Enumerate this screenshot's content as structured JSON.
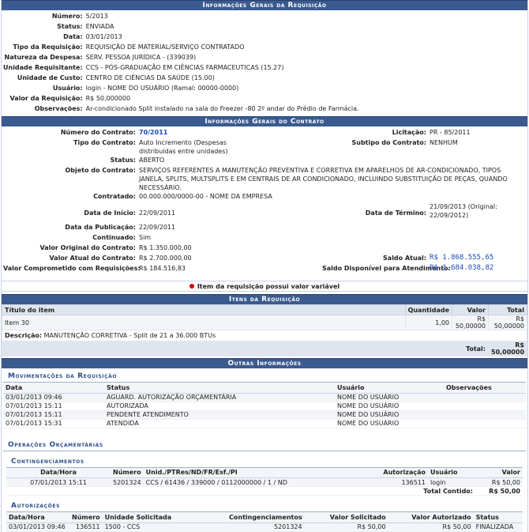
{
  "req": {
    "caption": "Informações Gerais da Requisição",
    "rows": [
      {
        "label": "Número:",
        "value": "5/2013"
      },
      {
        "label": "Status:",
        "value": "ENVIADA"
      },
      {
        "label": "Data:",
        "value": "03/01/2013"
      },
      {
        "label": "Tipo da Requisição:",
        "value": "REQUISIÇÃO DE MATERIAL/SERVIÇO CONTRATADO"
      },
      {
        "label": "Natureza da Despesa:",
        "value": "SERV. PESSOA JURÍDICA - (339039)"
      },
      {
        "label": "Unidade Requisitante:",
        "value": "CCS - PÓS-GRADUAÇÃO EM CIÊNCIAS FARMACEUTICAS (15.27)"
      },
      {
        "label": "Unidade de Custo:",
        "value": "CENTRO DE CIÊNCIAS DA SAÚDE (15.00)"
      },
      {
        "label": "Usuário:",
        "value": "login - NOME DO USUÁRIO (Ramal: 00000-0000)"
      },
      {
        "label": "Valor da Requisição:",
        "value": "R$ 50,000000"
      },
      {
        "label": "Observações:",
        "value": "Ar-condicionado Split instalado na sala do Freezer -80 2º andar do Prédio de Farmácia."
      }
    ]
  },
  "contract": {
    "caption": "Informações Gerais do Contrato",
    "numero_label": "Número do Contrato:",
    "numero": "70/2011",
    "licitacao_label": "Licitação:",
    "licitacao": "PR - 85/2011",
    "tipo_label": "Tipo do Contrato:",
    "tipo": "Auto Incremento (Despesas distribuídas entre unidades)",
    "subtipo_label": "Subtipo do Contrato:",
    "subtipo": "NENHUM",
    "status_label": "Status:",
    "status": "ABERTO",
    "objeto_label": "Objeto do Contrato:",
    "objeto": "SERVIÇOS REFERENTES A MANUTENÇÃO PREVENTIVA E CORRETIVA EM APARELHOS DE AR-CONDICIONADO, TIPOS JANELA, SPLITS, MULTSPLITS E EM CENTRAIS DE AR CONDICIONADO, INCLUINDO SUBSTITUIÇÃO DE PEÇAS, QUANDO NECESSÁRIO.",
    "contratado_label": "Contratado:",
    "contratado": "00.000.000/0000-00 - NOME DA EMPRESA",
    "inicio_label": "Data de Início:",
    "inicio": "22/09/2011",
    "termino_label": "Data de Término:",
    "termino": "21/09/2013 (Original: 22/09/2012)",
    "publicacao_label": "Data da Publicação:",
    "publicacao": "22/09/2011",
    "continuado_label": "Continuado:",
    "continuado": "Sim",
    "valor_original_label": "Valor Original do Contrato:",
    "valor_original": "R$ 1.350.000,00",
    "valor_atual_label": "Valor Atual do Contrato:",
    "valor_atual": "R$ 2.700.000,00",
    "saldo_atual_label": "Saldo Atual:",
    "saldo_atual": "R$ 1.868.555,65",
    "comprometido_label": "Valor Comprometido com Requisições:",
    "comprometido": "R$ 184.516,83",
    "saldo_disp_label": "Saldo Disponível para Atendimento:",
    "saldo_disp": "R$ 1.684.038,82"
  },
  "variable_note": "Item da requisição possui valor variável",
  "items": {
    "caption": "Itens da Requisição",
    "headers": {
      "titulo": "Título do item",
      "quantidade": "Quantidade",
      "valor": "Valor",
      "total": "Total"
    },
    "row": {
      "titulo": "Item 30",
      "quantidade": "1,00",
      "valor": "R$ 50,00000",
      "total": "R$ 50,00000"
    },
    "descricao_label": "Descrição:",
    "descricao": "MANUTENÇÃO CORRETIVA - Split de 21 a 36.000 BTUs",
    "total_label": "Total:",
    "total": "R$ 50,00000"
  },
  "other": {
    "caption": "Outras Informações",
    "mov_title": "Movimentações da Requisição",
    "mov_headers": {
      "data": "Data",
      "status": "Status",
      "usuario": "Usuário",
      "obs": "Observações"
    },
    "mov_rows": [
      {
        "data": "03/01/2013 09:46",
        "status": "AGUARD. AUTORIZAÇÃO ORÇAMENTÁRIA",
        "usuario": "NOME DO USUÁRIO"
      },
      {
        "data": "07/01/2013 15:11",
        "status": "AUTORIZADA",
        "usuario": "NOME DO USUÁRIO"
      },
      {
        "data": "07/01/2013 15:11",
        "status": "PENDENTE ATENDIMENTO",
        "usuario": "NOME DO USUÁRIO"
      },
      {
        "data": "07/01/2013 15:31",
        "status": "ATENDIDA",
        "usuario": "NOME DO USUÁRIO"
      }
    ],
    "orc_title": "Operações Orçamentárias",
    "cont_title": "Contingenciamentos",
    "cont_headers": {
      "data": "Data/Hora",
      "numero": "Número",
      "unid": "Unid./PTRes/ND/FR/Esf./PI",
      "aut": "Autorização",
      "usuario": "Usuário",
      "valor": "Valor"
    },
    "cont_row": {
      "data": "07/01/2013 15:11",
      "numero": "5201324",
      "unid": "CCS / 61436 / 339000 / 0112000000 / 1 / ND",
      "aut": "136511",
      "usuario": "login",
      "valor": "R$ 50,00"
    },
    "cont_total_label": "Total Contido:",
    "cont_total": "R$ 50,00",
    "aut_title": "Autorizações",
    "aut_headers": {
      "data": "Data/Hora",
      "numero": "Número",
      "unidade": "Unidade Solicitada",
      "cont": "Contingenciamentos",
      "solicitado": "Valor Solicitado",
      "autorizado": "Valor Autorizado",
      "status": "Status"
    },
    "aut_row": {
      "data": "03/01/2013 09:46",
      "numero": "136511",
      "unidade": "1500 - CCS",
      "cont": "5201324",
      "solicitado": "R$ 50,00",
      "autorizado": "R$ 50,00",
      "status": "FINALIZADA"
    }
  }
}
